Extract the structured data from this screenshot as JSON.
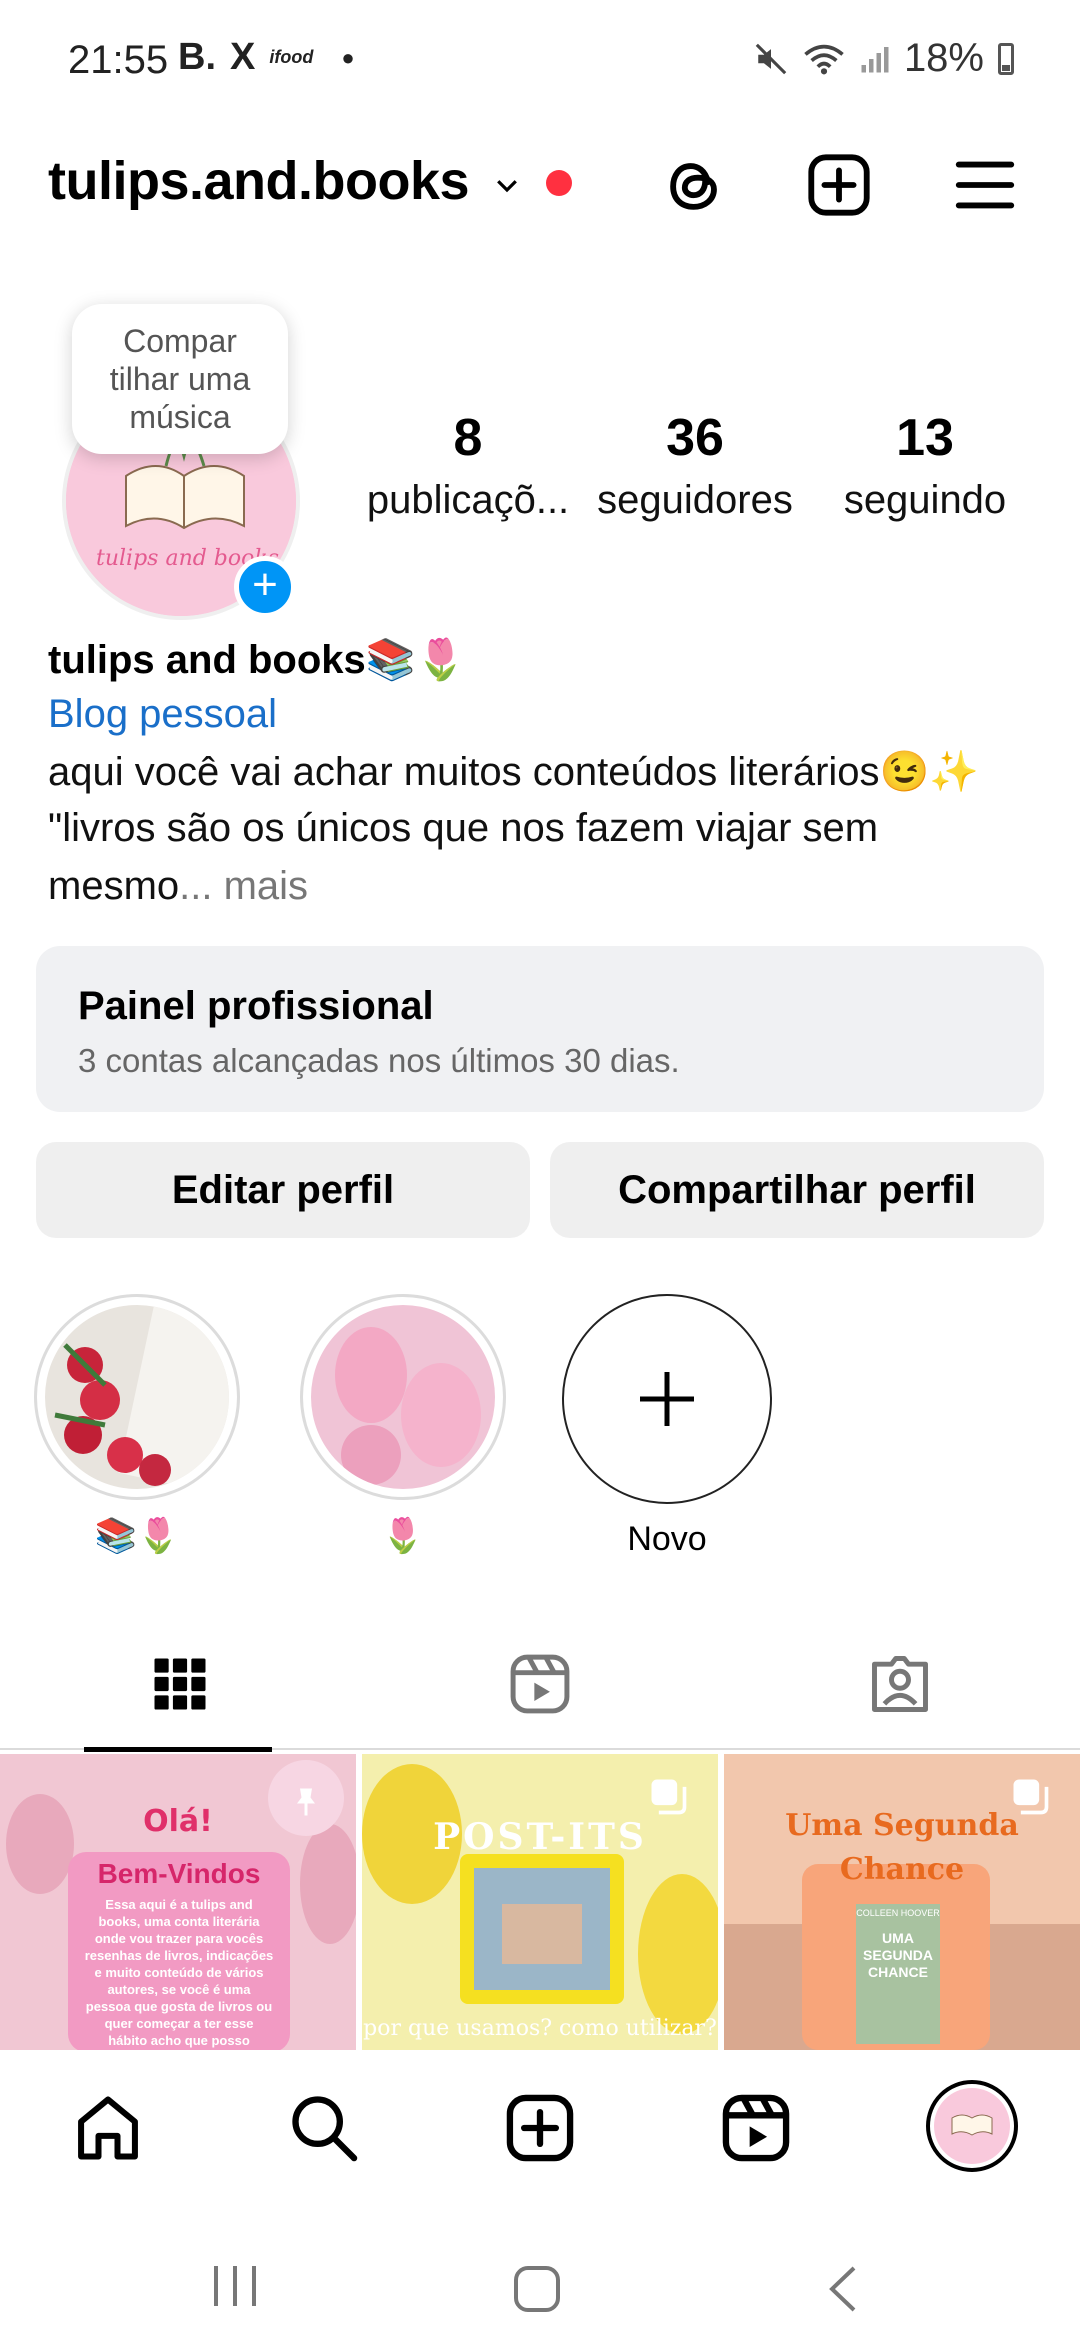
{
  "status_bar": {
    "time": "21:55",
    "app_icons": [
      "B.",
      "X",
      "ifood"
    ],
    "battery": "18%"
  },
  "header": {
    "username": "tulips.and.books"
  },
  "profile": {
    "music_prompt": "Compartilhar uma música",
    "music_prompt_lines": [
      "Compar",
      "tilhar uma",
      "música"
    ],
    "avatar_text": "tulips and books",
    "stats": [
      {
        "value": "8",
        "label": "publicaçõ..."
      },
      {
        "value": "36",
        "label": "seguidores"
      },
      {
        "value": "13",
        "label": "seguindo"
      }
    ],
    "display_name": "tulips and books📚🌷",
    "category": "Blog pessoal",
    "bio_line1": "aqui você vai achar muitos conteúdos literários😉✨",
    "bio_line2": "\"livros são os únicos que nos fazem viajar sem",
    "bio_line3": "mesmo",
    "bio_more": "... mais"
  },
  "professional_panel": {
    "title": "Painel profissional",
    "subtitle": "3 contas alcançadas nos últimos 30 dias."
  },
  "buttons": {
    "edit": "Editar perfil",
    "share": "Compartilhar perfil"
  },
  "highlights": [
    {
      "label": "📚🌷"
    },
    {
      "label": "🌷"
    },
    {
      "label": "Novo"
    }
  ],
  "tabs": [
    "grid",
    "reels",
    "tagged"
  ],
  "posts": [
    {
      "title": "Olá!",
      "subtitle": "Bem-Vindos",
      "text": "Essa aqui é a tulips and books, uma conta literária onde vou trazer para vocês resenhas de livros, indicações e muito conteúdo de vários autores, se você é uma pessoa que gosta de livros ou quer começar a ter esse hábito acho que posso"
    },
    {
      "title": "POST-ITS",
      "subtitle": "por que usamos? como utilizar?"
    },
    {
      "title": "Uma Segunda",
      "subtitle": "Chance",
      "book_author": "COLLEEN HOOVER",
      "book_title": "UMA SEGUNDA CHANCE"
    }
  ],
  "colors": {
    "link": "#1a6fc9",
    "notification": "#ff3040",
    "badge": "#0095f6",
    "panel_bg": "#f0f1f3"
  }
}
